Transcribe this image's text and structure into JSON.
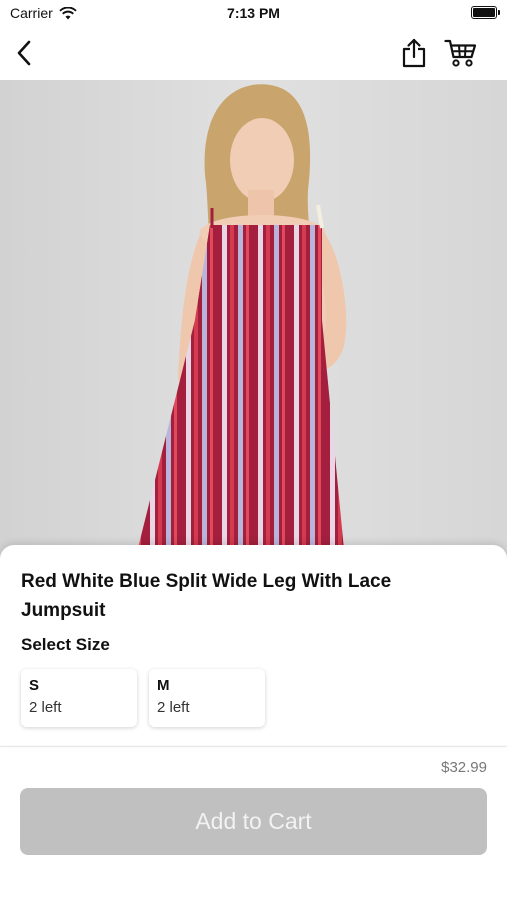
{
  "status_bar": {
    "carrier": "Carrier",
    "time": "7:13 PM"
  },
  "nav": {
    "back_icon": "chevron-left-icon",
    "share_icon": "share-icon",
    "cart_icon": "cart-icon"
  },
  "product": {
    "title": "Red White Blue Split Wide Leg With Lace Jumpsuit",
    "select_size_label": "Select Size",
    "sizes": [
      {
        "name": "S",
        "stock": "2 left"
      },
      {
        "name": "M",
        "stock": "2 left"
      }
    ],
    "price": "$32.99"
  },
  "actions": {
    "add_to_cart_label": "Add to Cart"
  },
  "colors": {
    "button_disabled": "#c0c0c0",
    "hero_background": "#d8d8d8"
  }
}
